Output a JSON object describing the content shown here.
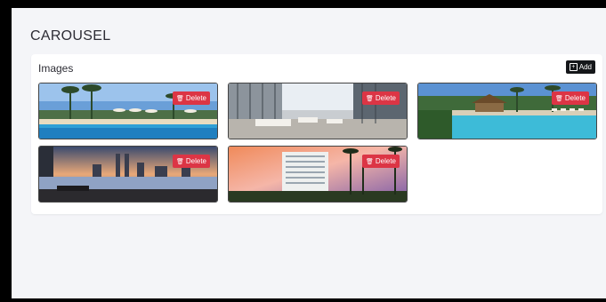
{
  "page": {
    "title": "CAROUSEL"
  },
  "images_card": {
    "title": "Images",
    "add_label": "Add",
    "items": [
      {
        "delete_label": "Delete",
        "scene": "resort-pool-palms"
      },
      {
        "delete_label": "Delete",
        "scene": "hotel-lobby"
      },
      {
        "delete_label": "Delete",
        "scene": "tropical-pool"
      },
      {
        "delete_label": "Delete",
        "scene": "city-skyline-infinity-pool"
      },
      {
        "delete_label": "Delete",
        "scene": "hotel-tower-sunset"
      }
    ]
  },
  "colors": {
    "delete": "#dc3545",
    "add": "#15171a"
  }
}
